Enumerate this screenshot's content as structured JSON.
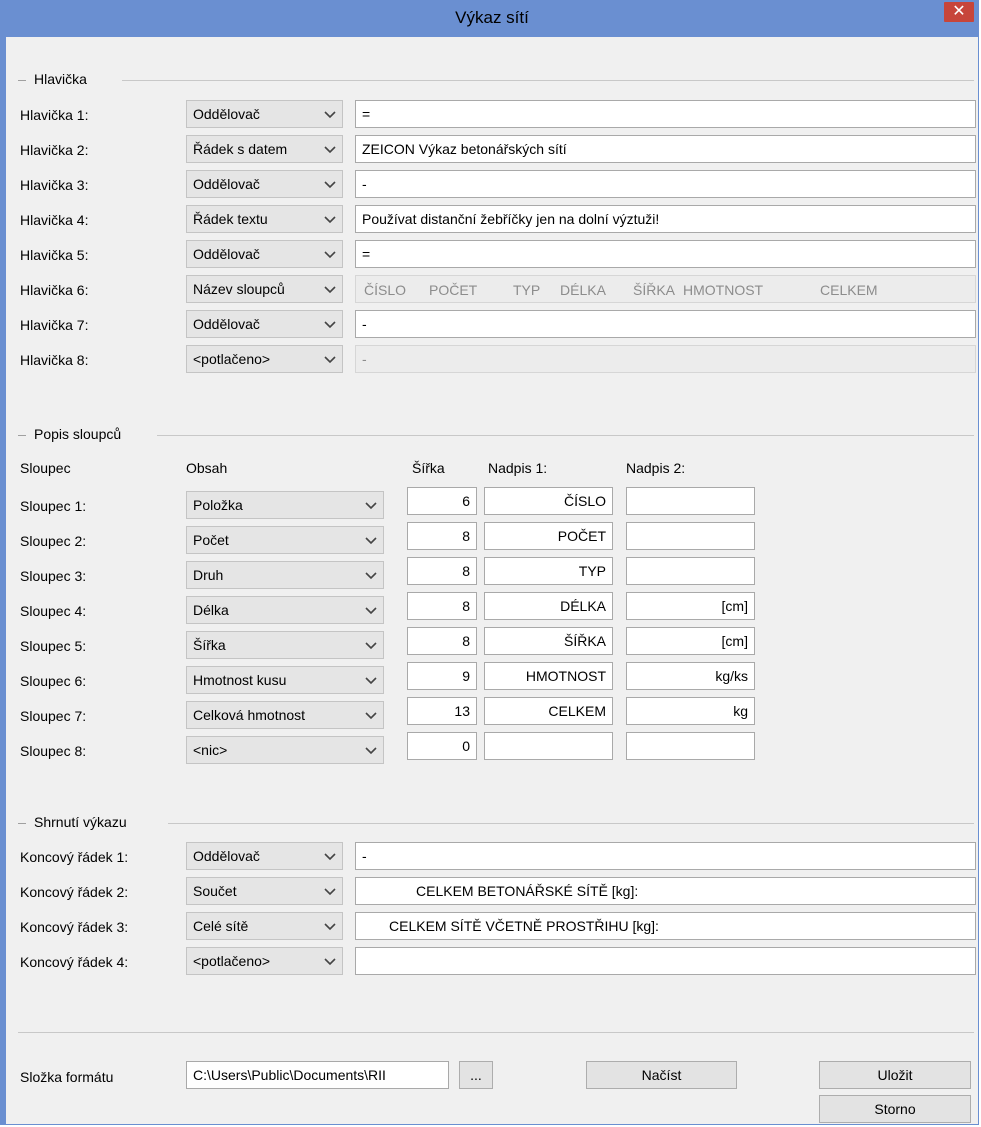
{
  "window": {
    "title": "Výkaz sítí",
    "close": "✕"
  },
  "hlavicka": {
    "group_title": "Hlavička",
    "rows": [
      {
        "label": "Hlavička 1:",
        "type": "Oddělovač",
        "value": "="
      },
      {
        "label": "Hlavička 2:",
        "type": "Řádek s datem",
        "value": "ZEICON Výkaz betonářských sítí"
      },
      {
        "label": "Hlavička 3:",
        "type": "Oddělovač",
        "value": "-"
      },
      {
        "label": "Hlavička 4:",
        "type": "Řádek textu",
        "value": "Používat distanční žebříčky jen na dolní výztuži!"
      },
      {
        "label": "Hlavička 5:",
        "type": "Oddělovač",
        "value": "="
      },
      {
        "label": "Hlavička 6:",
        "type": "Název sloupců",
        "value": ""
      },
      {
        "label": "Hlavička 7:",
        "type": "Oddělovač",
        "value": "-"
      },
      {
        "label": "Hlavička 8:",
        "type": "<potlačeno>",
        "value": "-"
      }
    ],
    "column_names": [
      "ČÍSLO",
      "POČET",
      "TYP",
      "DÉLKA",
      "ŠÍŘKA",
      "HMOTNOST",
      "CELKEM"
    ]
  },
  "popis": {
    "group_title": "Popis sloupců",
    "headers": {
      "sloupec": "Sloupec",
      "obsah": "Obsah",
      "sirka": "Šířka",
      "nadpis1": "Nadpis 1:",
      "nadpis2": "Nadpis 2:"
    },
    "rows": [
      {
        "label": "Sloupec 1:",
        "content": "Položka",
        "width": "6",
        "title1": "ČÍSLO",
        "title2": ""
      },
      {
        "label": "Sloupec 2:",
        "content": "Počet",
        "width": "8",
        "title1": "POČET",
        "title2": ""
      },
      {
        "label": "Sloupec 3:",
        "content": "Druh",
        "width": "8",
        "title1": "TYP",
        "title2": ""
      },
      {
        "label": "Sloupec 4:",
        "content": "Délka",
        "width": "8",
        "title1": "DÉLKA",
        "title2": "[cm]"
      },
      {
        "label": "Sloupec 5:",
        "content": "Šířka",
        "width": "8",
        "title1": "ŠÍŘKA",
        "title2": "[cm]"
      },
      {
        "label": "Sloupec 6:",
        "content": "Hmotnost kusu",
        "width": "9",
        "title1": "HMOTNOST",
        "title2": "kg/ks"
      },
      {
        "label": "Sloupec 7:",
        "content": "Celková hmotnost",
        "width": "13",
        "title1": "CELKEM",
        "title2": "kg"
      },
      {
        "label": "Sloupec 8:",
        "content": "<nic>",
        "width": "0",
        "title1": "",
        "title2": ""
      }
    ]
  },
  "shrnuti": {
    "group_title": "Shrnutí výkazu",
    "rows": [
      {
        "label": "Koncový řádek 1:",
        "type": "Oddělovač",
        "value": "-"
      },
      {
        "label": "Koncový řádek 2:",
        "type": "Součet",
        "value": "CELKEM BETONÁŘSKÉ SÍTĚ [kg]:"
      },
      {
        "label": "Koncový řádek 3:",
        "type": "Celé sítě",
        "value": "CELKEM SÍTĚ VČETNĚ PROSTŘIHU [kg]:"
      },
      {
        "label": "Koncový řádek 4:",
        "type": "<potlačeno>",
        "value": ""
      }
    ]
  },
  "footer": {
    "folder_label": "Složka formátu",
    "folder_value": "C:\\Users\\Public\\Documents\\RII",
    "browse": "...",
    "load": "Načíst",
    "save": "Uložit",
    "cancel": "Storno"
  }
}
